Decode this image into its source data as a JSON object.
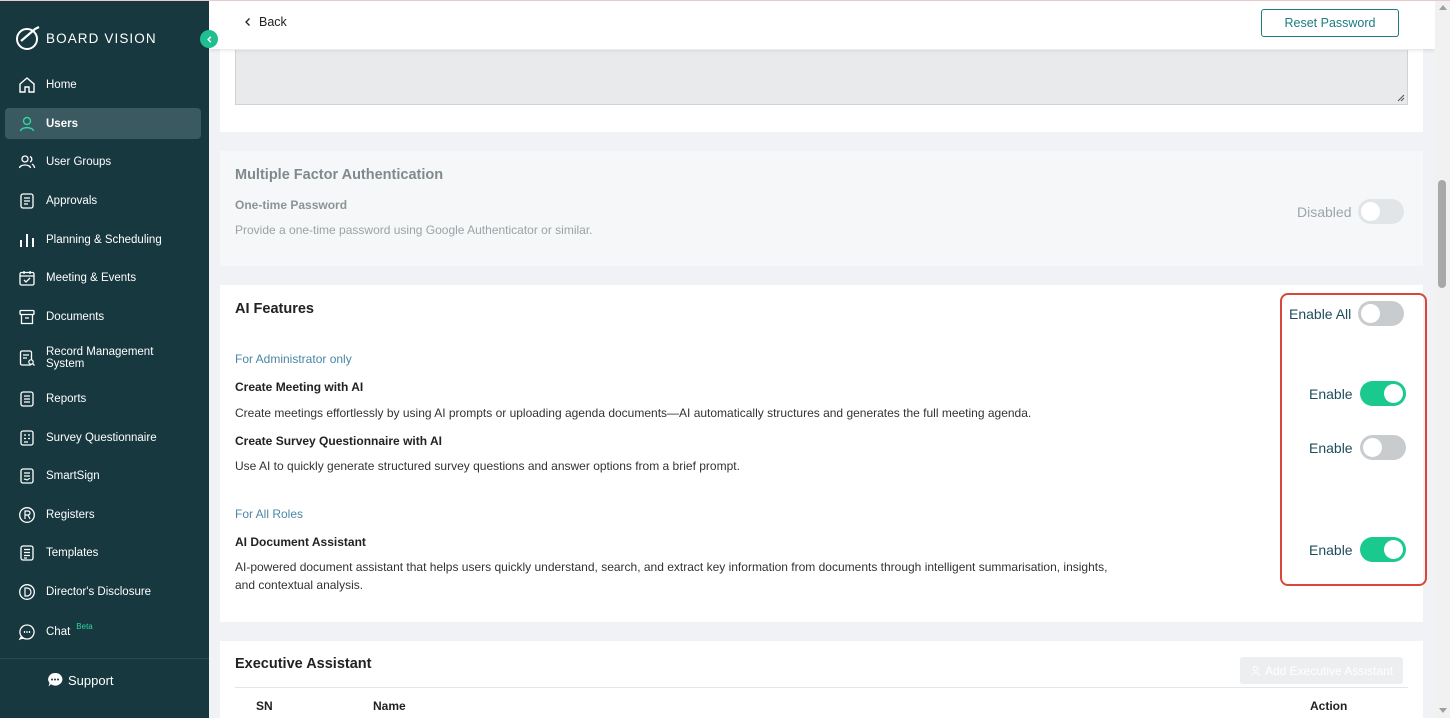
{
  "app": {
    "logo_text": "BOARD VISION"
  },
  "sidebar": {
    "items": [
      {
        "label": "Home",
        "icon": "home-icon"
      },
      {
        "label": "Users",
        "icon": "user-icon",
        "active": true
      },
      {
        "label": "User Groups",
        "icon": "users-icon"
      },
      {
        "label": "Approvals",
        "icon": "approvals-icon"
      },
      {
        "label": "Planning & Scheduling",
        "icon": "bar-chart-icon"
      },
      {
        "label": "Meeting & Events",
        "icon": "calendar-check-icon"
      },
      {
        "label": "Documents",
        "icon": "archive-icon"
      },
      {
        "label": "Record Management System",
        "icon": "record-search-icon"
      },
      {
        "label": "Reports",
        "icon": "report-icon"
      },
      {
        "label": "Survey Questionnaire",
        "icon": "survey-icon"
      },
      {
        "label": "SmartSign",
        "icon": "sign-icon"
      },
      {
        "label": "Registers",
        "icon": "registers-r-icon"
      },
      {
        "label": "Templates",
        "icon": "templates-icon"
      },
      {
        "label": "Director's Disclosure",
        "icon": "disclosure-d-icon"
      },
      {
        "label": "Chat",
        "icon": "chat-icon",
        "badge": "Beta"
      }
    ],
    "support_label": "Support"
  },
  "topbar": {
    "back_label": "Back",
    "reset_password_label": "Reset Password"
  },
  "mfa": {
    "title": "Multiple Factor Authentication",
    "otp_title": "One-time Password",
    "otp_desc": "Provide a one-time password using Google Authenticator or similar.",
    "toggle_label": "Disabled",
    "toggle_on": false
  },
  "ai": {
    "title": "AI Features",
    "enable_all_label": "Enable All",
    "enable_all_on": false,
    "admin_section": "For Administrator only",
    "all_roles_section": "For All Roles",
    "features": [
      {
        "title": "Create Meeting with AI",
        "desc": "Create meetings effortlessly by using AI prompts or uploading agenda documents—AI automatically structures and generates the full meeting agenda.",
        "toggle_label": "Enable",
        "on": true
      },
      {
        "title": "Create Survey Questionnaire with AI",
        "desc": "Use AI to quickly generate structured survey questions and answer options from a brief prompt.",
        "toggle_label": "Enable",
        "on": false
      },
      {
        "title": "AI Document Assistant",
        "desc": "AI-powered document assistant that helps users quickly understand, search, and extract key information from documents through intelligent summarisation, insights, and contextual analysis.",
        "toggle_label": "Enable",
        "on": true
      }
    ]
  },
  "executive": {
    "title": "Executive Assistant",
    "add_label": "Add Executive Assistant",
    "columns": [
      "SN",
      "Name",
      "Action"
    ]
  },
  "colors": {
    "sidebar_bg": "#17383f",
    "accent_green": "#19c98e",
    "teal_button": "#1c7c80",
    "highlight_red": "#d9473c"
  }
}
